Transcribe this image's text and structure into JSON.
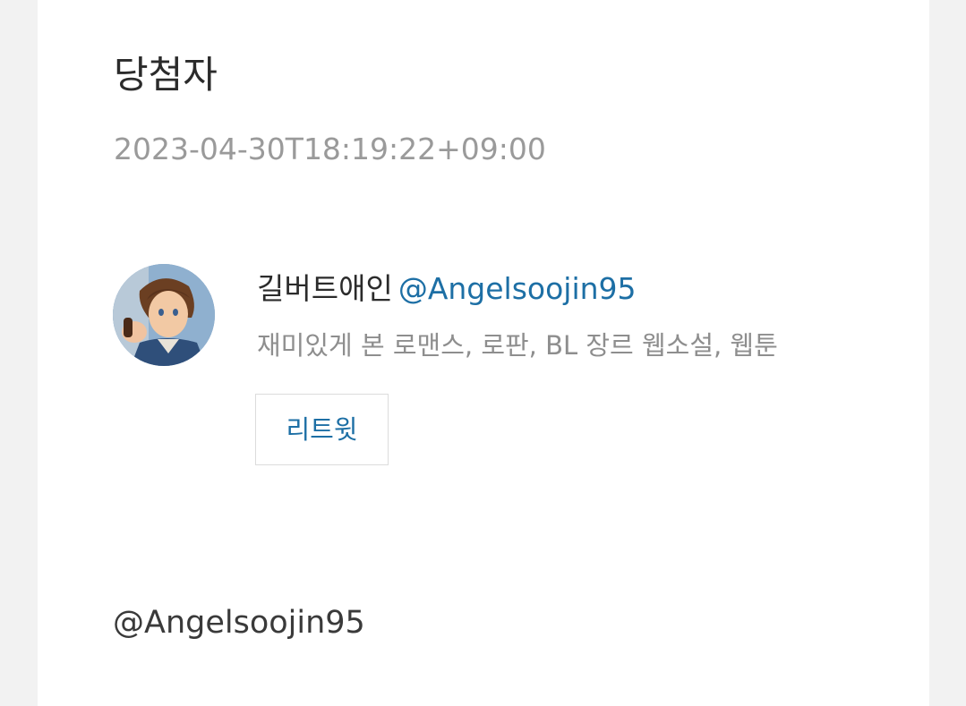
{
  "card": {
    "title": "당첨자",
    "timestamp": "2023-04-30T18:19:22+09:00"
  },
  "winner": {
    "avatar_icon": "profile-avatar",
    "display_name": "길버트애인",
    "handle": "@Angelsoojin95",
    "bio": "재미있게 본 로맨스, 로판, BL 장르 웹소설, 웹툰",
    "retweet_label": "리트윗"
  },
  "mention": "@Angelsoojin95",
  "colors": {
    "background": "#f2f2f2",
    "card": "#ffffff",
    "link": "#1d6fa5",
    "muted": "#9a9a9a"
  }
}
